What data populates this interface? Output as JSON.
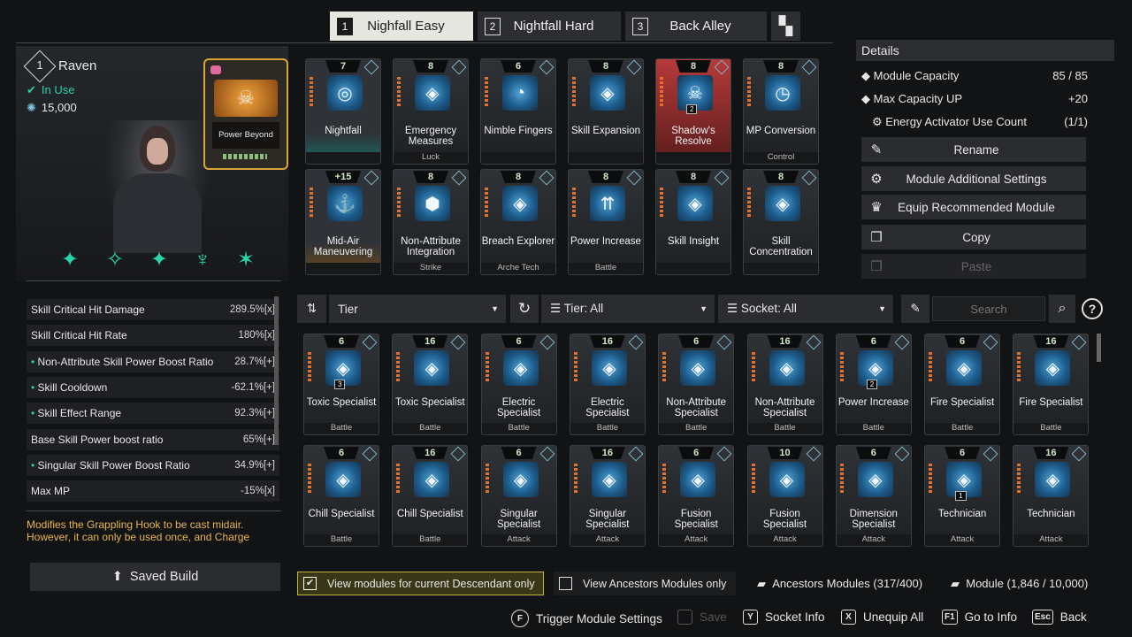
{
  "tabs": [
    {
      "num": "1",
      "label": "Nighfall Easy"
    },
    {
      "num": "2",
      "label": "Nightfall Hard"
    },
    {
      "num": "3",
      "label": "Back Alley"
    }
  ],
  "character": {
    "level": "1",
    "name": "Raven",
    "status": "In Use",
    "cost": "15,000",
    "reactor_label": "Power Beyond"
  },
  "equipped": [
    {
      "cap": "7",
      "name": "Nightfall",
      "sub": "",
      "icon": "swirl-icon"
    },
    {
      "cap": "8",
      "name": "Emergency Measures",
      "sub": "Luck",
      "icon": "diamond-icon"
    },
    {
      "cap": "6",
      "name": "Nimble Fingers",
      "sub": "",
      "icon": "dial-icon"
    },
    {
      "cap": "8",
      "name": "Skill Expansion",
      "sub": "",
      "icon": "diamond-icon"
    },
    {
      "cap": "8",
      "name": "Shadow's Resolve",
      "sub": "",
      "icon": "skull-icon",
      "badge": "2"
    },
    {
      "cap": "8",
      "name": "MP Conversion",
      "sub": "Control",
      "icon": "gauge-icon"
    },
    {
      "cap": "+15",
      "name": "Mid-Air Maneuvering",
      "sub": "",
      "icon": "hook-icon"
    },
    {
      "cap": "8",
      "name": "Non-Attribute Integration",
      "sub": "Strike",
      "icon": "gem-icon"
    },
    {
      "cap": "8",
      "name": "Breach Explorer",
      "sub": "Arche Tech",
      "icon": "diamond-icon"
    },
    {
      "cap": "8",
      "name": "Power Increase",
      "sub": "Battle",
      "icon": "arrows-icon"
    },
    {
      "cap": "8",
      "name": "Skill Insight",
      "sub": "",
      "icon": "diamond-icon"
    },
    {
      "cap": "8",
      "name": "Skill Concentration",
      "sub": "",
      "icon": "diamond-icon"
    }
  ],
  "stats": [
    {
      "name": "Skill Critical Hit Damage",
      "value": "289.5%[x]"
    },
    {
      "name": "Skill Critical Hit Rate",
      "value": "180%[x]"
    },
    {
      "name": "Non-Attribute Skill Power Boost Ratio",
      "value": "28.7%[+]"
    },
    {
      "name": "Skill Cooldown",
      "value": "-62.1%[+]"
    },
    {
      "name": "Skill Effect Range",
      "value": "92.3%[+]"
    },
    {
      "name": "Base Skill Power boost ratio",
      "value": "65%[+]"
    },
    {
      "name": "Singular Skill Power Boost Ratio",
      "value": "34.9%[+]"
    },
    {
      "name": "Max MP",
      "value": "-15%[x]"
    }
  ],
  "description": "Modifies the Grappling Hook to be cast midair. However, it can only be used once, and Charge Time",
  "saved_build": "Saved Build",
  "details": {
    "title": "Details",
    "module_capacity_label": "Module Capacity",
    "module_capacity": "85 / 85",
    "max_capacity_label": "Max Capacity UP",
    "max_capacity": "+20",
    "energy_label": "Energy Activator Use Count",
    "energy": "(1/1)"
  },
  "detail_buttons": [
    "Rename",
    "Module Additional Settings",
    "Equip Recommended Module",
    "Copy",
    "Paste"
  ],
  "filters": {
    "sort": "Tier",
    "tier": "Tier: All",
    "socket": "Socket: All",
    "search_placeholder": "Search"
  },
  "inventory": [
    {
      "cap": "6",
      "name": "Toxic Specialist",
      "sub": "Battle",
      "badge": "3"
    },
    {
      "cap": "16",
      "name": "Toxic Specialist",
      "sub": "Battle"
    },
    {
      "cap": "6",
      "name": "Electric Specialist",
      "sub": "Battle"
    },
    {
      "cap": "16",
      "name": "Electric Specialist",
      "sub": "Battle"
    },
    {
      "cap": "6",
      "name": "Non-Attribute Specialist",
      "sub": "Battle"
    },
    {
      "cap": "16",
      "name": "Non-Attribute Specialist",
      "sub": "Battle"
    },
    {
      "cap": "6",
      "name": "Power Increase",
      "sub": "Battle",
      "badge": "2"
    },
    {
      "cap": "6",
      "name": "Fire Specialist",
      "sub": "Battle"
    },
    {
      "cap": "16",
      "name": "Fire Specialist",
      "sub": "Battle"
    },
    {
      "cap": "6",
      "name": "Chill Specialist",
      "sub": "Battle"
    },
    {
      "cap": "16",
      "name": "Chill Specialist",
      "sub": "Battle"
    },
    {
      "cap": "6",
      "name": "Singular Specialist",
      "sub": "Attack"
    },
    {
      "cap": "16",
      "name": "Singular Specialist",
      "sub": "Attack"
    },
    {
      "cap": "6",
      "name": "Fusion Specialist",
      "sub": "Attack"
    },
    {
      "cap": "10",
      "name": "Fusion Specialist",
      "sub": "Attack"
    },
    {
      "cap": "6",
      "name": "Dimension Specialist",
      "sub": "Attack"
    },
    {
      "cap": "6",
      "name": "Technician",
      "sub": "Attack",
      "badge": "1"
    },
    {
      "cap": "16",
      "name": "Technician",
      "sub": "Attack"
    }
  ],
  "checkboxes": {
    "current": "View modules for current Descendant only",
    "ancestors": "View Ancestors Modules only"
  },
  "counts": {
    "ancestors": "Ancestors Modules (317/400)",
    "modules": "Module (1,846 / 10,000)"
  },
  "hints": [
    {
      "key": "F",
      "label": "Trigger Module Settings"
    },
    {
      "key": "",
      "label": "Save"
    },
    {
      "key": "Y",
      "label": "Socket Info"
    },
    {
      "key": "X",
      "label": "Unequip All"
    },
    {
      "key": "F1",
      "label": "Go to Info"
    },
    {
      "key": "Esc",
      "label": "Back"
    }
  ],
  "colors": {
    "accent_orange": "#e5702a",
    "accent_green": "#2ad2a8",
    "gold": "#d9a534"
  }
}
